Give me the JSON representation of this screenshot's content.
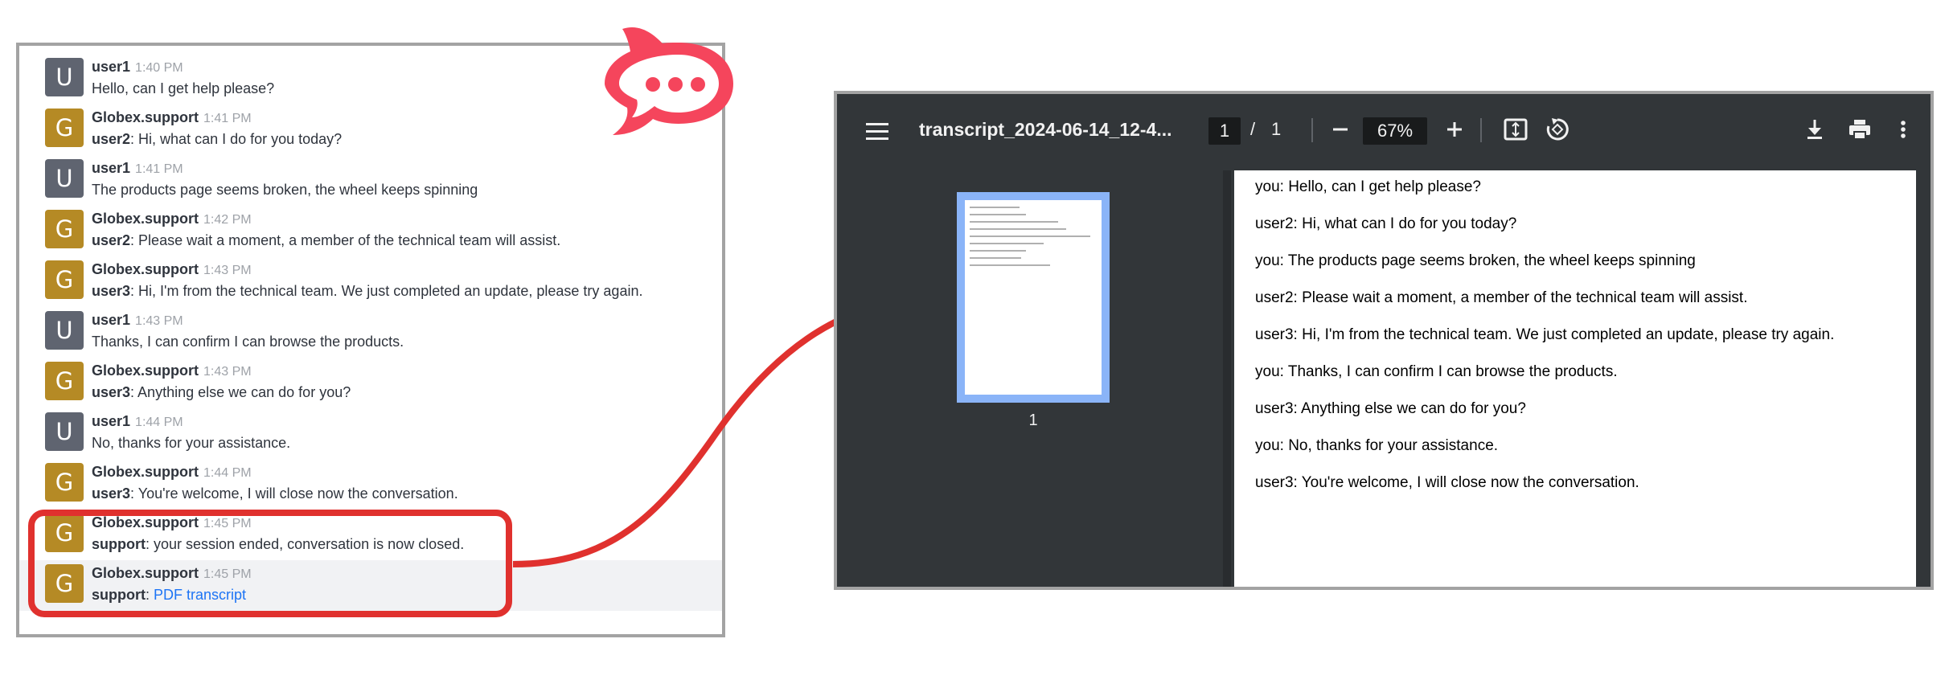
{
  "chat": {
    "messages": [
      {
        "avatar": "U",
        "type": "u",
        "user": "user1",
        "time": "1:40 PM",
        "speaker": "",
        "text": "Hello, can I get help please?"
      },
      {
        "avatar": "G",
        "type": "g",
        "user": "Globex.support",
        "time": "1:41 PM",
        "speaker": "user2",
        "text": ": Hi, what can I do for you today?"
      },
      {
        "avatar": "U",
        "type": "u",
        "user": "user1",
        "time": "1:41 PM",
        "speaker": "",
        "text": "The products page seems broken, the wheel keeps spinning"
      },
      {
        "avatar": "G",
        "type": "g",
        "user": "Globex.support",
        "time": "1:42 PM",
        "speaker": "user2",
        "text": ": Please wait a moment, a member of the technical team will assist."
      },
      {
        "avatar": "G",
        "type": "g",
        "user": "Globex.support",
        "time": "1:43 PM",
        "speaker": "user3",
        "text": ": Hi, I'm from the technical team. We just completed an update, please try again."
      },
      {
        "avatar": "U",
        "type": "u",
        "user": "user1",
        "time": "1:43 PM",
        "speaker": "",
        "text": "Thanks, I can confirm I can browse the products."
      },
      {
        "avatar": "G",
        "type": "g",
        "user": "Globex.support",
        "time": "1:43 PM",
        "speaker": "user3",
        "text": ": Anything else we can do for you?"
      },
      {
        "avatar": "U",
        "type": "u",
        "user": "user1",
        "time": "1:44 PM",
        "speaker": "",
        "text": "No, thanks for your assistance."
      },
      {
        "avatar": "G",
        "type": "g",
        "user": "Globex.support",
        "time": "1:44 PM",
        "speaker": "user3",
        "text": ": You're welcome, I will close now the conversation."
      },
      {
        "avatar": "G",
        "type": "g",
        "user": "Globex.support",
        "time": "1:45 PM",
        "speaker": "support",
        "text": ": your session ended, conversation is now closed."
      },
      {
        "avatar": "G",
        "type": "g",
        "user": "Globex.support",
        "time": "1:45 PM",
        "speaker": "support",
        "text": ": ",
        "link": "PDF transcript"
      }
    ]
  },
  "pdf": {
    "title": "transcript_2024-06-14_12-4...",
    "current_page": "1",
    "page_separator": "/",
    "total_pages": "1",
    "zoom": "67%",
    "thumbnail_label": "1",
    "lines": [
      "you: Hello, can I get help please?",
      "user2: Hi, what can I do for you today?",
      "you: The products page seems broken, the wheel keeps spinning",
      "user2: Please wait a moment, a member of the technical team will assist.",
      "user3: Hi, I'm from the technical team. We just completed an update, please try again.",
      "you: Thanks, I can confirm I can browse the products.",
      "user3: Anything else we can do for you?",
      "you: No, thanks for your assistance.",
      "user3: You're welcome, I will close now the conversation."
    ],
    "icons": [
      "menu-icon",
      "zoom-out-icon",
      "zoom-in-icon",
      "fit-page-icon",
      "rotate-icon",
      "download-icon",
      "print-icon",
      "more-icon"
    ]
  },
  "colors": {
    "accent_red": "#e0312e",
    "logo_red": "#f5455c",
    "avatar_user": "#5f6470",
    "avatar_support": "#b58a25",
    "link": "#1d74f5",
    "viewer_bg": "#323639",
    "thumb_border": "#8ab4f8"
  }
}
